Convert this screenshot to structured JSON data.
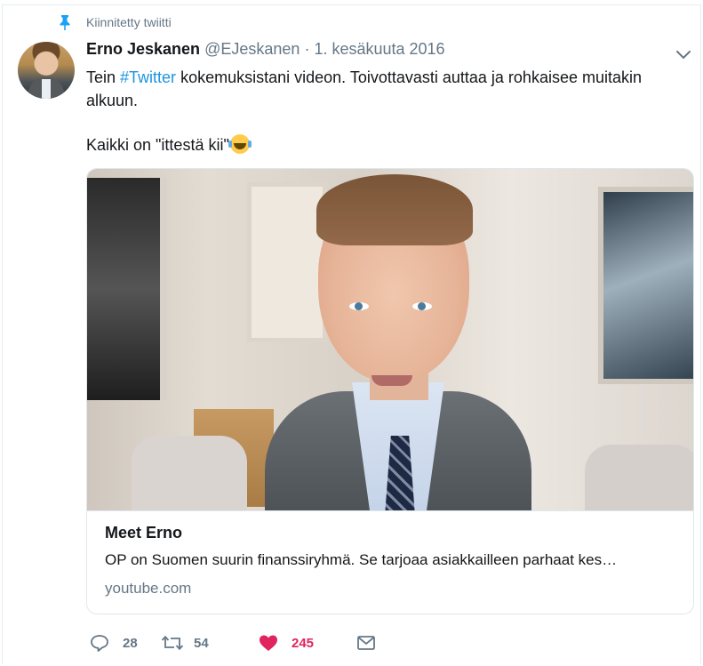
{
  "pinned": {
    "label": "Kiinnitetty twiitti"
  },
  "author": {
    "name": "Erno Jeskanen",
    "handle": "@EJeskanen",
    "separator": "·",
    "date": "1. kesäkuuta 2016"
  },
  "tweet": {
    "line1_prefix": "Tein ",
    "hashtag": "#Twitter",
    "line1_suffix": " kokemuksistani videon. Toivottavasti auttaa ja rohkaisee muitakin alkuun.",
    "line2": "Kaikki on \"ittestä kii\""
  },
  "card": {
    "title": "Meet Erno",
    "description": "OP on Suomen suurin finanssiryhmä. Se tarjoaa asiakkailleen parhaat kes…",
    "domain": "youtube.com"
  },
  "actions": {
    "replies": "28",
    "retweets": "54",
    "likes": "245"
  },
  "colors": {
    "accent": "#1b95e0",
    "muted": "#657786",
    "like": "#e0245e"
  },
  "icons": [
    "pin-icon",
    "chevron-down-icon",
    "reply-icon",
    "retweet-icon",
    "heart-icon",
    "mail-icon",
    "emoji-tears-of-joy-icon"
  ]
}
